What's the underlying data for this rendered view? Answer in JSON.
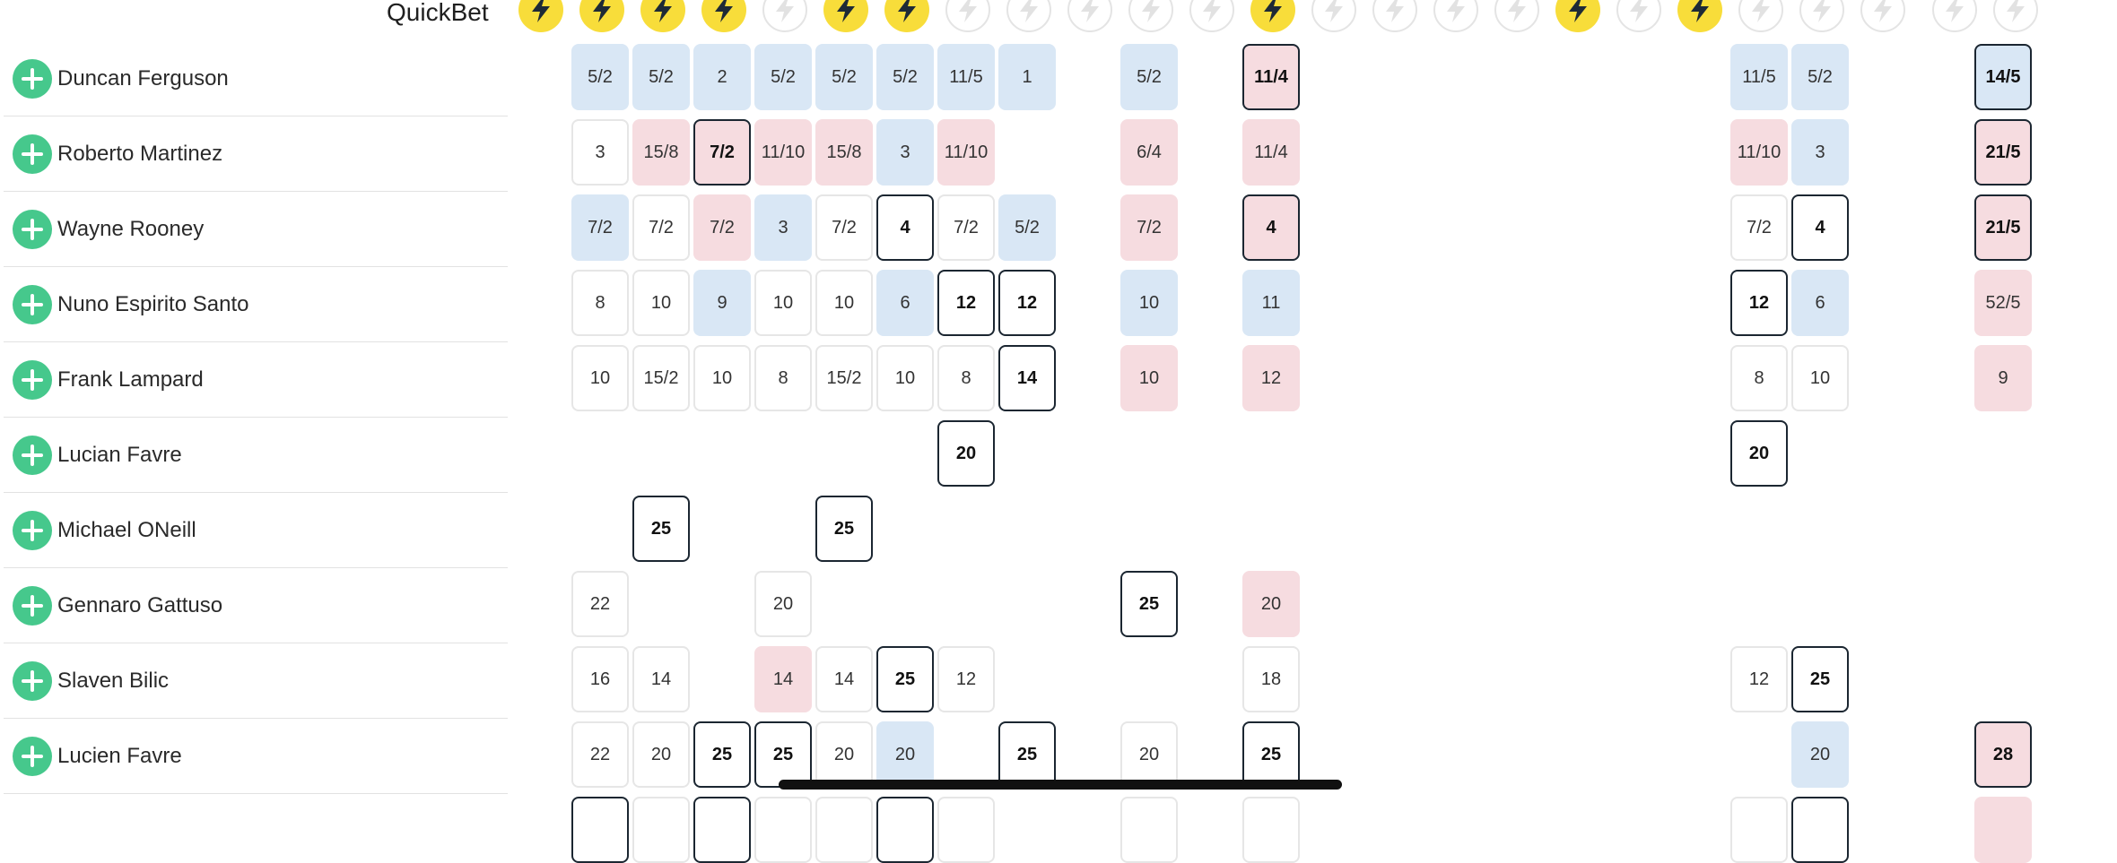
{
  "header": {
    "quickbet_label": "QuickBet",
    "bolt_icon": "lightning-bolt-icon",
    "bolt_columns": [
      {
        "active": true
      },
      {
        "active": true
      },
      {
        "active": true
      },
      {
        "active": true
      },
      {
        "active": false
      },
      {
        "active": true
      },
      {
        "active": true
      },
      {
        "active": false
      },
      {
        "active": false
      },
      {
        "active": false
      },
      {
        "active": false
      },
      {
        "active": false
      },
      {
        "active": true
      },
      {
        "active": false
      },
      {
        "active": false
      },
      {
        "active": false
      },
      {
        "active": false
      },
      {
        "active": true
      },
      {
        "active": false
      },
      {
        "active": true
      },
      {
        "active": false
      },
      {
        "active": false
      },
      {
        "active": false
      },
      {
        "active": false
      },
      {
        "active": false
      }
    ]
  },
  "colors": {
    "bolt_active": "#f8dd3a",
    "add_button": "#46c88c",
    "odds_drifting": "#d9e7f5",
    "odds_shortening": "#f6dce0",
    "best_price_border": "#1b2631"
  },
  "add_icon": "plus-circle-icon",
  "selections": [
    {
      "name": "Duncan Ferguson",
      "odds": [
        {
          "c": 0,
          "v": "5/2",
          "s": "b"
        },
        {
          "c": 1,
          "v": "5/2",
          "s": "b"
        },
        {
          "c": 2,
          "v": "2",
          "s": "b"
        },
        {
          "c": 3,
          "v": "5/2",
          "s": "b"
        },
        {
          "c": 4,
          "v": "5/2",
          "s": "b"
        },
        {
          "c": 5,
          "v": "5/2",
          "s": "b"
        },
        {
          "c": 6,
          "v": "11/5",
          "s": "b"
        },
        {
          "c": 7,
          "v": "1",
          "s": "b"
        },
        {
          "c": 9,
          "v": "5/2",
          "s": "b"
        },
        {
          "c": 11,
          "v": "11/4",
          "s": "pk"
        },
        {
          "c": 19,
          "v": "11/5",
          "s": "b"
        },
        {
          "c": 20,
          "v": "5/2",
          "s": "b"
        },
        {
          "c": 23,
          "v": "14/5",
          "s": "bk"
        }
      ]
    },
    {
      "name": "Roberto Martinez",
      "odds": [
        {
          "c": 0,
          "v": "3",
          "s": "w"
        },
        {
          "c": 1,
          "v": "15/8",
          "s": "p"
        },
        {
          "c": 2,
          "v": "7/2",
          "s": "pk"
        },
        {
          "c": 3,
          "v": "11/10",
          "s": "p"
        },
        {
          "c": 4,
          "v": "15/8",
          "s": "p"
        },
        {
          "c": 5,
          "v": "3",
          "s": "b"
        },
        {
          "c": 6,
          "v": "11/10",
          "s": "p"
        },
        {
          "c": 9,
          "v": "6/4",
          "s": "p"
        },
        {
          "c": 11,
          "v": "11/4",
          "s": "p"
        },
        {
          "c": 19,
          "v": "11/10",
          "s": "p"
        },
        {
          "c": 20,
          "v": "3",
          "s": "b"
        },
        {
          "c": 23,
          "v": "21/5",
          "s": "pk"
        }
      ]
    },
    {
      "name": "Wayne Rooney",
      "odds": [
        {
          "c": 0,
          "v": "7/2",
          "s": "b"
        },
        {
          "c": 1,
          "v": "7/2",
          "s": "w"
        },
        {
          "c": 2,
          "v": "7/2",
          "s": "p"
        },
        {
          "c": 3,
          "v": "3",
          "s": "b"
        },
        {
          "c": 4,
          "v": "7/2",
          "s": "w"
        },
        {
          "c": 5,
          "v": "4",
          "s": "k"
        },
        {
          "c": 6,
          "v": "7/2",
          "s": "w"
        },
        {
          "c": 7,
          "v": "5/2",
          "s": "b"
        },
        {
          "c": 9,
          "v": "7/2",
          "s": "p"
        },
        {
          "c": 11,
          "v": "4",
          "s": "pk"
        },
        {
          "c": 19,
          "v": "7/2",
          "s": "w"
        },
        {
          "c": 20,
          "v": "4",
          "s": "k"
        },
        {
          "c": 23,
          "v": "21/5",
          "s": "pk"
        }
      ]
    },
    {
      "name": "Nuno Espirito Santo",
      "odds": [
        {
          "c": 0,
          "v": "8",
          "s": "w"
        },
        {
          "c": 1,
          "v": "10",
          "s": "w"
        },
        {
          "c": 2,
          "v": "9",
          "s": "b"
        },
        {
          "c": 3,
          "v": "10",
          "s": "w"
        },
        {
          "c": 4,
          "v": "10",
          "s": "w"
        },
        {
          "c": 5,
          "v": "6",
          "s": "b"
        },
        {
          "c": 6,
          "v": "12",
          "s": "k"
        },
        {
          "c": 7,
          "v": "12",
          "s": "k"
        },
        {
          "c": 9,
          "v": "10",
          "s": "b"
        },
        {
          "c": 11,
          "v": "11",
          "s": "b"
        },
        {
          "c": 19,
          "v": "12",
          "s": "k"
        },
        {
          "c": 20,
          "v": "6",
          "s": "b"
        },
        {
          "c": 23,
          "v": "52/5",
          "s": "p"
        }
      ]
    },
    {
      "name": "Frank Lampard",
      "odds": [
        {
          "c": 0,
          "v": "10",
          "s": "w"
        },
        {
          "c": 1,
          "v": "15/2",
          "s": "w"
        },
        {
          "c": 2,
          "v": "10",
          "s": "w"
        },
        {
          "c": 3,
          "v": "8",
          "s": "w"
        },
        {
          "c": 4,
          "v": "15/2",
          "s": "w"
        },
        {
          "c": 5,
          "v": "10",
          "s": "w"
        },
        {
          "c": 6,
          "v": "8",
          "s": "w"
        },
        {
          "c": 7,
          "v": "14",
          "s": "k"
        },
        {
          "c": 9,
          "v": "10",
          "s": "p"
        },
        {
          "c": 11,
          "v": "12",
          "s": "p"
        },
        {
          "c": 19,
          "v": "8",
          "s": "w"
        },
        {
          "c": 20,
          "v": "10",
          "s": "w"
        },
        {
          "c": 23,
          "v": "9",
          "s": "p"
        }
      ]
    },
    {
      "name": "Lucian Favre",
      "odds": [
        {
          "c": 6,
          "v": "20",
          "s": "k"
        },
        {
          "c": 19,
          "v": "20",
          "s": "k"
        }
      ]
    },
    {
      "name": "Michael ONeill",
      "odds": [
        {
          "c": 1,
          "v": "25",
          "s": "k"
        },
        {
          "c": 4,
          "v": "25",
          "s": "k"
        }
      ]
    },
    {
      "name": "Gennaro Gattuso",
      "odds": [
        {
          "c": 0,
          "v": "22",
          "s": "w"
        },
        {
          "c": 3,
          "v": "20",
          "s": "w"
        },
        {
          "c": 9,
          "v": "25",
          "s": "k"
        },
        {
          "c": 11,
          "v": "20",
          "s": "p"
        }
      ]
    },
    {
      "name": "Slaven Bilic",
      "odds": [
        {
          "c": 0,
          "v": "16",
          "s": "w"
        },
        {
          "c": 1,
          "v": "14",
          "s": "w"
        },
        {
          "c": 3,
          "v": "14",
          "s": "p"
        },
        {
          "c": 4,
          "v": "14",
          "s": "w"
        },
        {
          "c": 5,
          "v": "25",
          "s": "k"
        },
        {
          "c": 6,
          "v": "12",
          "s": "w"
        },
        {
          "c": 11,
          "v": "18",
          "s": "w"
        },
        {
          "c": 19,
          "v": "12",
          "s": "w"
        },
        {
          "c": 20,
          "v": "25",
          "s": "k"
        }
      ]
    },
    {
      "name": "Lucien Favre",
      "odds": [
        {
          "c": 0,
          "v": "22",
          "s": "w"
        },
        {
          "c": 1,
          "v": "20",
          "s": "w"
        },
        {
          "c": 2,
          "v": "25",
          "s": "k"
        },
        {
          "c": 3,
          "v": "25",
          "s": "k"
        },
        {
          "c": 4,
          "v": "20",
          "s": "w"
        },
        {
          "c": 5,
          "v": "20",
          "s": "b"
        },
        {
          "c": 7,
          "v": "25",
          "s": "k"
        },
        {
          "c": 9,
          "v": "20",
          "s": "w"
        },
        {
          "c": 11,
          "v": "25",
          "s": "k"
        },
        {
          "c": 20,
          "v": "20",
          "s": "b"
        },
        {
          "c": 23,
          "v": "28",
          "s": "pk"
        }
      ]
    }
  ],
  "partial_row": {
    "odds": [
      {
        "c": 0,
        "s": "k"
      },
      {
        "c": 1,
        "s": "w"
      },
      {
        "c": 2,
        "s": "k"
      },
      {
        "c": 3,
        "s": "w"
      },
      {
        "c": 4,
        "s": "w"
      },
      {
        "c": 5,
        "s": "k"
      },
      {
        "c": 6,
        "s": "w"
      },
      {
        "c": 9,
        "s": "w"
      },
      {
        "c": 11,
        "s": "w"
      },
      {
        "c": 19,
        "s": "w"
      },
      {
        "c": 20,
        "s": "k"
      },
      {
        "c": 23,
        "s": "p"
      }
    ]
  }
}
